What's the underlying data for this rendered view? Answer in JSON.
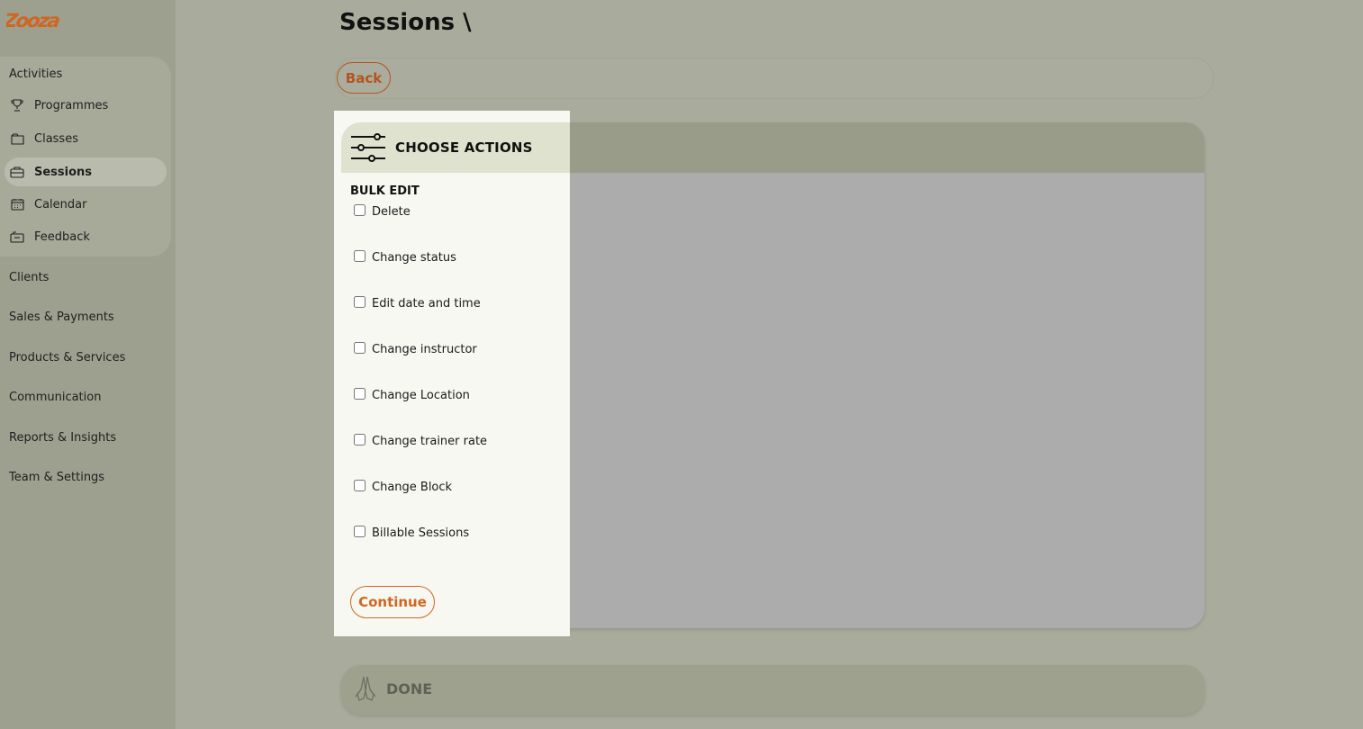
{
  "brand": {
    "logo_text": "Zooza",
    "accent_color": "#d0661f"
  },
  "page": {
    "title": "Sessions \\"
  },
  "sidebar": {
    "activities_heading": "Activities",
    "activities_items": [
      {
        "label": "Programmes",
        "icon": "trophy-icon"
      },
      {
        "label": "Classes",
        "icon": "folder-icon"
      },
      {
        "label": "Sessions",
        "icon": "briefcase-icon",
        "active": true
      },
      {
        "label": "Calendar",
        "icon": "calendar-icon"
      },
      {
        "label": "Feedback",
        "icon": "feedback-icon"
      }
    ],
    "top_items": [
      "Clients",
      "Sales & Payments",
      "Products & Services",
      "Communication",
      "Reports & Insights",
      "Team & Settings"
    ]
  },
  "toolbar": {
    "back_label": "Back"
  },
  "actions_panel": {
    "title": "CHOOSE ACTIONS",
    "section_label": "BULK EDIT",
    "options": [
      "Delete",
      "Change status",
      "Edit date and time",
      "Change instructor",
      "Change Location",
      "Change trainer rate",
      "Change Block",
      "Billable Sessions"
    ],
    "continue_label": "Continue"
  },
  "done_step": {
    "label": "DONE"
  }
}
